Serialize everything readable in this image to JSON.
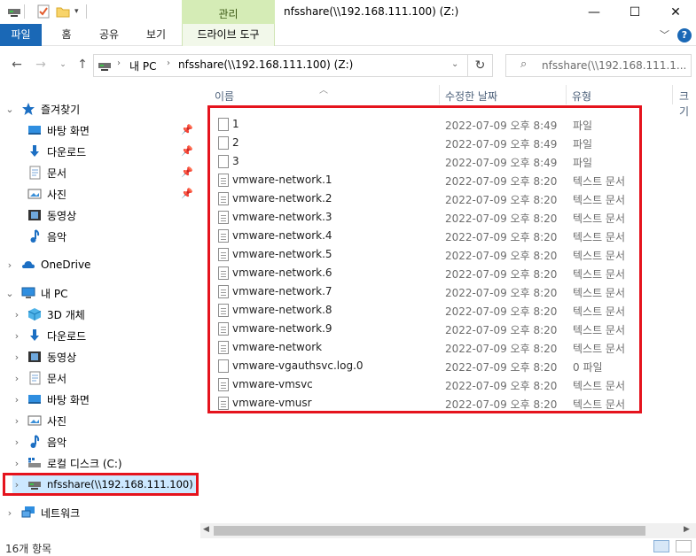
{
  "titlebar": {
    "context_tab": "관리",
    "title": "nfsshare(\\\\192.168.111.100) (Z:)",
    "minimize": "—",
    "maximize": "☐",
    "close": "✕"
  },
  "ribbon": {
    "tabs": [
      "파일",
      "홈",
      "공유",
      "보기"
    ],
    "drive_tools": "드라이브 도구",
    "help": "?"
  },
  "address": {
    "path_pc": "내 PC",
    "path_drive": "nfsshare(\\\\192.168.111.100) (Z:)",
    "search_placeholder": "nfsshare(\\\\192.168.111.1..."
  },
  "navpane": {
    "quick_access": "즐겨찾기",
    "quick_items": [
      "바탕 화면",
      "다운로드",
      "문서",
      "사진",
      "동영상",
      "음악"
    ],
    "onedrive": "OneDrive",
    "this_pc": "내 PC",
    "pc_items": [
      "3D 개체",
      "다운로드",
      "동영상",
      "문서",
      "바탕 화면",
      "사진",
      "음악",
      "로컬 디스크 (C:)",
      "nfsshare(\\\\192.168.111.100)"
    ],
    "network": "네트워크"
  },
  "columns": {
    "name": "이름",
    "date": "수정한 날짜",
    "type": "유형",
    "size": "크기"
  },
  "files": [
    {
      "name": "1",
      "date": "2022-07-09 오후 8:49",
      "type": "파일",
      "icon": "file"
    },
    {
      "name": "2",
      "date": "2022-07-09 오후 8:49",
      "type": "파일",
      "icon": "file"
    },
    {
      "name": "3",
      "date": "2022-07-09 오후 8:49",
      "type": "파일",
      "icon": "file"
    },
    {
      "name": "vmware-network.1",
      "date": "2022-07-09 오후 8:20",
      "type": "텍스트 문서",
      "icon": "text"
    },
    {
      "name": "vmware-network.2",
      "date": "2022-07-09 오후 8:20",
      "type": "텍스트 문서",
      "icon": "text"
    },
    {
      "name": "vmware-network.3",
      "date": "2022-07-09 오후 8:20",
      "type": "텍스트 문서",
      "icon": "text"
    },
    {
      "name": "vmware-network.4",
      "date": "2022-07-09 오후 8:20",
      "type": "텍스트 문서",
      "icon": "text"
    },
    {
      "name": "vmware-network.5",
      "date": "2022-07-09 오후 8:20",
      "type": "텍스트 문서",
      "icon": "text"
    },
    {
      "name": "vmware-network.6",
      "date": "2022-07-09 오후 8:20",
      "type": "텍스트 문서",
      "icon": "text"
    },
    {
      "name": "vmware-network.7",
      "date": "2022-07-09 오후 8:20",
      "type": "텍스트 문서",
      "icon": "text"
    },
    {
      "name": "vmware-network.8",
      "date": "2022-07-09 오후 8:20",
      "type": "텍스트 문서",
      "icon": "text"
    },
    {
      "name": "vmware-network.9",
      "date": "2022-07-09 오후 8:20",
      "type": "텍스트 문서",
      "icon": "text"
    },
    {
      "name": "vmware-network",
      "date": "2022-07-09 오후 8:20",
      "type": "텍스트 문서",
      "icon": "text"
    },
    {
      "name": "vmware-vgauthsvc.log.0",
      "date": "2022-07-09 오후 8:20",
      "type": "0 파일",
      "icon": "file"
    },
    {
      "name": "vmware-vmsvc",
      "date": "2022-07-09 오후 8:20",
      "type": "텍스트 문서",
      "icon": "text"
    },
    {
      "name": "vmware-vmusr",
      "date": "2022-07-09 오후 8:20",
      "type": "텍스트 문서",
      "icon": "text"
    }
  ],
  "status": {
    "count": "16개 항목"
  },
  "colors": {
    "accent": "#1a68b6",
    "highlight_border": "#e5131d",
    "context_tab": "#d5ecb6"
  }
}
